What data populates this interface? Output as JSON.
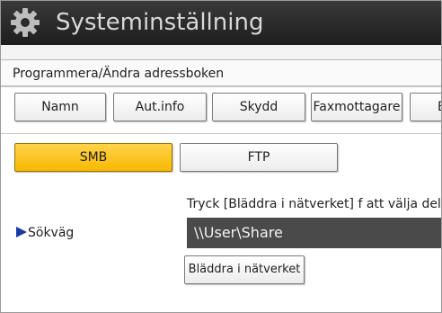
{
  "header": {
    "title": "Systeminställning",
    "icon": "gear-icon"
  },
  "subheader": {
    "title": "Programmera/Ändra adressboken"
  },
  "tabs": [
    {
      "label": "Namn"
    },
    {
      "label": "Aut.info"
    },
    {
      "label": "Skydd"
    },
    {
      "label": "Faxmottagare"
    },
    {
      "label": "E"
    }
  ],
  "protocol": {
    "options": [
      {
        "label": "SMB",
        "selected": true
      },
      {
        "label": "FTP",
        "selected": false
      }
    ]
  },
  "path": {
    "hint": "Tryck [Bläddra i nätverket] f att välja delad",
    "label": "Sökväg",
    "value": "\\\\User\\Share",
    "browse_label": "Bläddra i nätverket"
  },
  "colors": {
    "selected": "#f7b900",
    "titlebar": "#1e1e1e",
    "marker": "#1a3aa8"
  }
}
